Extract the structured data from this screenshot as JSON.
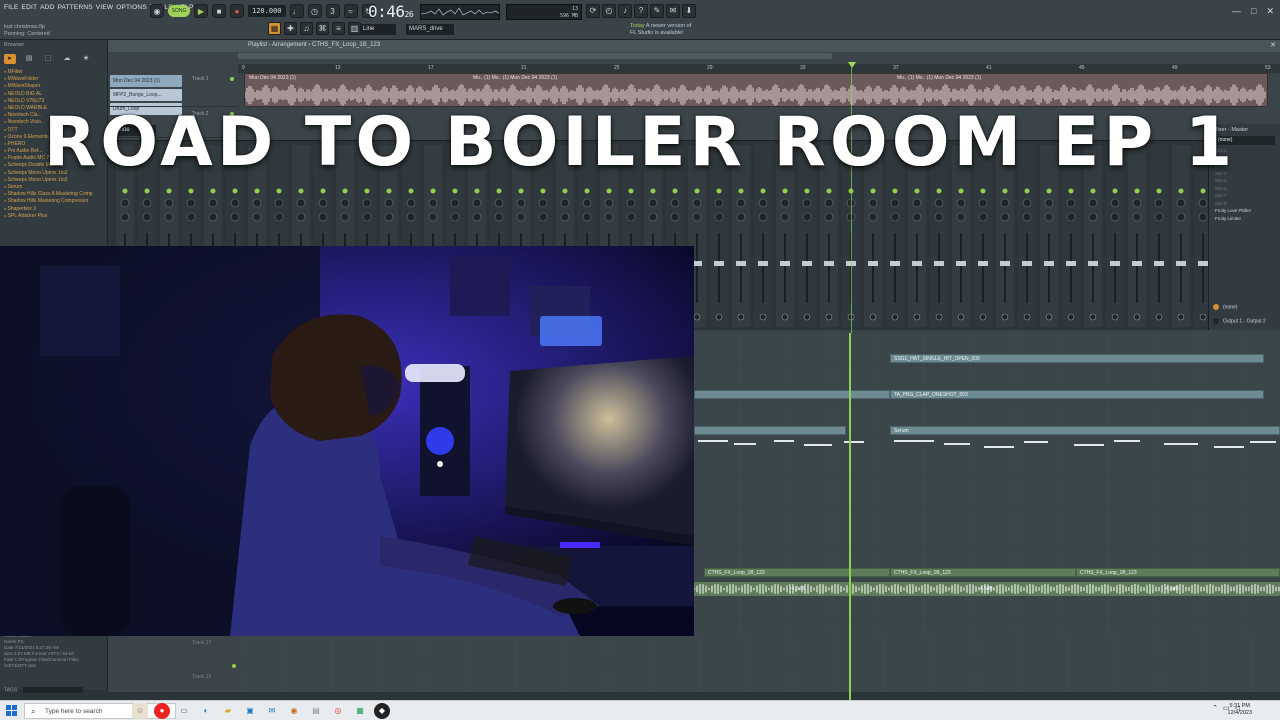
{
  "title_overlay": "ROAD TO BOILER ROOM EP 1",
  "topbar": {
    "menu": [
      "FILE",
      "EDIT",
      "ADD",
      "PATTERNS",
      "VIEW",
      "OPTIONS",
      "TOOLS",
      "HELP"
    ],
    "project_file": "lost christmas.flp",
    "project_status": "Panning: Centered",
    "pat_song": "SONG",
    "tempo": "120.000",
    "time_main": "0:46",
    "time_sub": "26",
    "cpu_mem": "596 MB",
    "cpu_val": "13",
    "cpu_polys": "8",
    "snap": "Line",
    "mixer_track": "MARS_drive",
    "news_label": "Today",
    "news_text_1": "A newer version of",
    "news_text_2": "FL Studio is available!"
  },
  "browser": {
    "header": "Browser",
    "items": [
      "MFilter",
      "MWaveFolder",
      "MWaveShaper",
      "NEOLD BIG AL",
      "NEOLD V76U73",
      "NEOLD WARBLE",
      "Novotech Cla...",
      "Novotech Visio...",
      "OTT",
      "Ozone 9 Elements",
      "PHERO",
      "Pro Audio Ref...",
      "Purple Audio MC 77",
      "Scheeps Double MS",
      "Scheeps Mono Upmix 1to2",
      "Scheeps Mono Upmix 1to3",
      "Serum",
      "Shadow Hills Class A Mastering Comp",
      "Shadow Hills Mastering Compressor",
      "Shaperbox 3",
      "SPL Attacker Plus"
    ],
    "info": [
      "Author   OSSX",
      "Genre    FX",
      "Date     7/14/2021 5:47:26 AM",
      "Size     2.07 MB      Format   VST3 / 64-bit",
      "Path     C:\\Program Files\\Common Files",
      "         \\VST3\\OTT.vst3"
    ],
    "tags_label": "TAGS"
  },
  "playlist": {
    "title": "Playlist - Arrangement",
    "pattern": "CTHS_FX_Loop_1B_123",
    "patterns": [
      "Mon Dec 04 2023 (1)",
      "MFP2_Bongo_Loop...",
      "Drum_Loop"
    ],
    "track_names": [
      "Track 1",
      "Track 2",
      "Track 17",
      "Track 18"
    ],
    "ruler_marks": [
      "9",
      "13",
      "17",
      "21",
      "25",
      "29",
      "33",
      "37",
      "41",
      "45",
      "49",
      "53",
      "57"
    ],
    "audio_clip_label": "Mon Dec 04 2023 (1)",
    "audio_clip_label2": "Mo.. (1)  Mo.. (1)  Mon Dec 04 2023 (1)",
    "audio_clip_label3": "Mo.. (1)  Mo.. (1)  Mon Dec 04 2023 (1)",
    "clip_labels": {
      "hat": "SSG1_HAT_SINGLE_HIT_OPEN_009",
      "clap": "TA_PBG_CLAP_ONESHOT_003",
      "serum": "Serum",
      "fx1": "CTHS_FX_Loop_1B_123",
      "fx2": "CTHS_FX_Loop_1B_123",
      "fx3": "CTHS_FX_Loop_1B_123",
      "db1": "-4.5dB",
      "db2": "-4.5dB",
      "db3": "-4.5dB"
    }
  },
  "mixer": {
    "wide": "Wide",
    "right_title": "Mixer - Master",
    "right_select": "(none)",
    "slots": [
      "Slot 1",
      "Slot 2",
      "Slot 3",
      "Slot 4",
      "Slot 5",
      "Slot 6",
      "Slot 7",
      "Slot 8"
    ],
    "fx1": "Fruity Love Philter",
    "fx2": "Fruity Limiter",
    "out_none": "(none)",
    "out_main": "Output 1 - Output 2"
  },
  "taskbar": {
    "search_placeholder": "Type here to search",
    "time": "5:31 PM",
    "date": "12/4/2023"
  },
  "colors": {
    "accent_orange": "#d8912f",
    "accent_green": "#8fd14f",
    "bg_dark": "#2b3439"
  }
}
